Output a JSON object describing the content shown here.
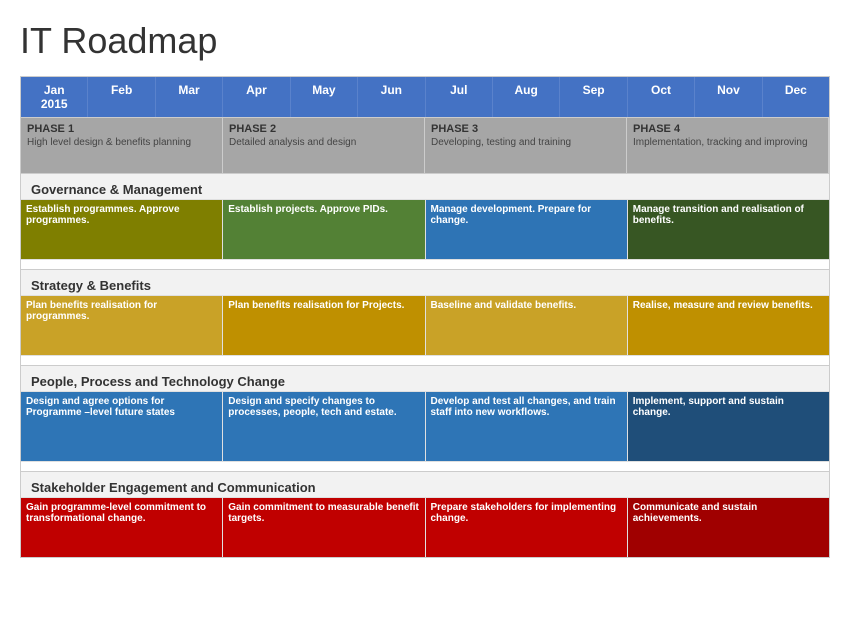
{
  "title": "IT Roadmap",
  "months": [
    "Jan\n2015",
    "Feb",
    "Mar",
    "Apr",
    "May",
    "Jun",
    "Jul",
    "Aug",
    "Sep",
    "Oct",
    "Nov",
    "Dec"
  ],
  "phases": [
    {
      "title": "PHASE 1",
      "desc": "High level design & benefits planning",
      "span": 3
    },
    {
      "title": "PHASE 2",
      "desc": "Detailed analysis and design",
      "span": 3
    },
    {
      "title": "PHASE 3",
      "desc": "Developing, testing and training",
      "span": 3
    },
    {
      "title": "PHASE 4",
      "desc": "Implementation, tracking and improving",
      "span": 3
    }
  ],
  "sections": [
    {
      "title": "Governance & Management",
      "tasks": [
        {
          "text": "Establish programmes. Approve programmes.",
          "color": "olive",
          "span": 3
        },
        {
          "text": "Establish projects. Approve PIDs.",
          "color": "green",
          "span": 3
        },
        {
          "text": "Manage development. Prepare for change.",
          "color": "blue",
          "span": 3
        },
        {
          "text": "Manage transition and realisation of benefits.",
          "color": "dark-green",
          "span": 3
        }
      ]
    },
    {
      "title": "Strategy & Benefits",
      "tasks": [
        {
          "text": "Plan benefits realisation for programmes.",
          "color": "gold",
          "span": 3
        },
        {
          "text": "Plan benefits realisation for Projects.",
          "color": "dark-gold",
          "span": 3
        },
        {
          "text": "Baseline and validate benefits.",
          "color": "gold",
          "span": 3
        },
        {
          "text": "Realise, measure and review benefits.",
          "color": "dark-gold",
          "span": 3
        }
      ]
    },
    {
      "title": "People, Process and Technology Change",
      "tasks": [
        {
          "text": "Design and agree options for Programme –level future states",
          "color": "blue2",
          "span": 3
        },
        {
          "text": "Design and specify changes to processes, people, tech and estate.",
          "color": "blue2",
          "span": 3
        },
        {
          "text": "Develop and test all changes, and train staff into new workflows.",
          "color": "blue2",
          "span": 3
        },
        {
          "text": "Implement, support and sustain change.",
          "color": "dark-blue",
          "span": 3
        }
      ]
    },
    {
      "title": "Stakeholder Engagement and Communication",
      "tasks": [
        {
          "text": "Gain programme-level commitment to transformational change.",
          "color": "red",
          "span": 3
        },
        {
          "text": "Gain commitment to measurable benefit targets.",
          "color": "red",
          "span": 3
        },
        {
          "text": "Prepare stakeholders for implementing change.",
          "color": "red",
          "span": 3
        },
        {
          "text": "Communicate and sustain achievements.",
          "color": "dark-red",
          "span": 3
        }
      ]
    }
  ]
}
